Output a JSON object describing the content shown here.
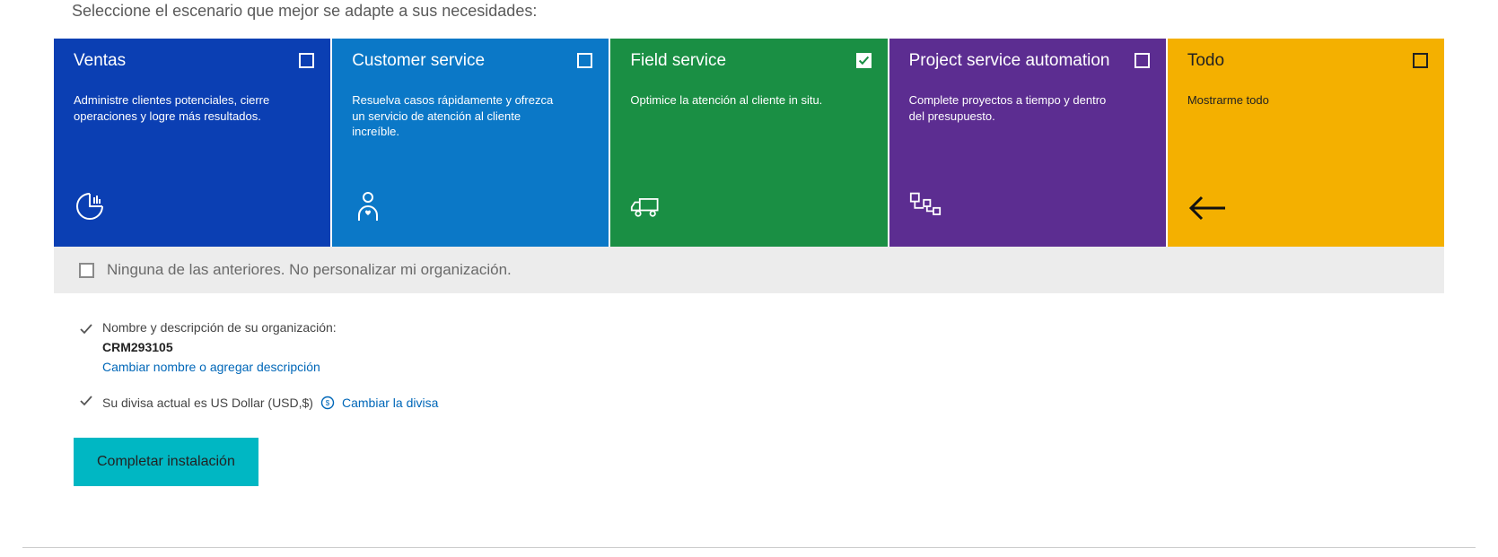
{
  "intro": "Seleccione el escenario que mejor se adapte a sus necesidades:",
  "tiles": {
    "sales": {
      "title": "Ventas",
      "desc": "Administre clientes potenciales, cierre operaciones y logre más resultados.",
      "checked": false
    },
    "customer": {
      "title": "Customer service",
      "desc": "Resuelva casos rápidamente y ofrezca un servicio de atención al cliente increíble.",
      "checked": false
    },
    "field": {
      "title": "Field service",
      "desc": "Optimice la atención al cliente in situ.",
      "checked": true
    },
    "project": {
      "title": "Project service automation",
      "desc": "Complete proyectos a tiempo y dentro del presupuesto.",
      "checked": false
    },
    "todo": {
      "title": "Todo",
      "desc": "Mostrarme todo",
      "checked": false
    }
  },
  "none_option": "Ninguna de las anteriores. No personalizar mi organización.",
  "org": {
    "label": "Nombre y descripción de su organización:",
    "name": "CRM293105",
    "edit_link": "Cambiar nombre o agregar descripción"
  },
  "currency": {
    "label": "Su divisa actual es US Dollar (USD,$)",
    "edit_link": "Cambiar la divisa"
  },
  "complete_button": "Completar instalación"
}
